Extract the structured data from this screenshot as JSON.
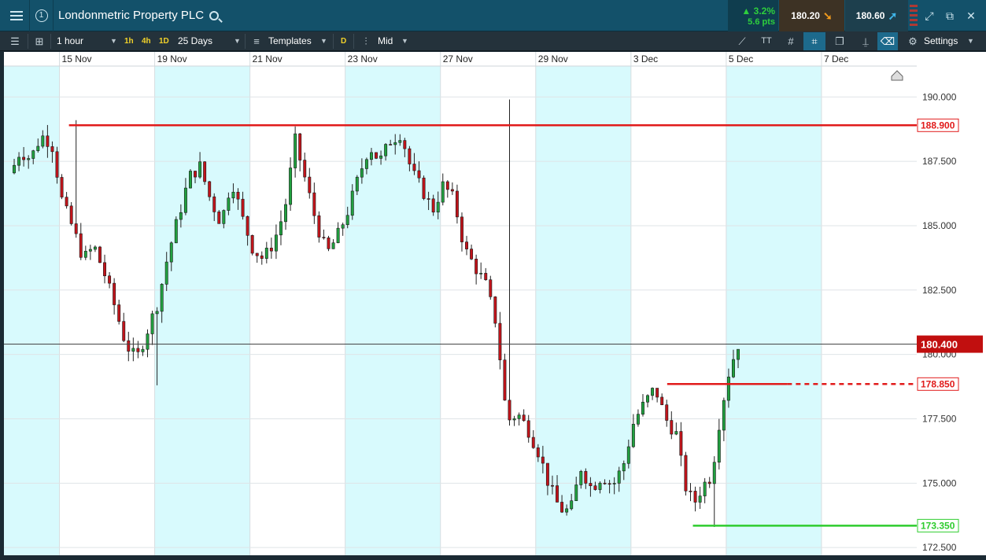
{
  "header": {
    "instrument": "Londonmetric Property PLC",
    "change_pct": "3.2%",
    "change_pts": "5.6 pts",
    "sell_price": "180.20",
    "buy_price": "180.60"
  },
  "toolbar": {
    "interval": "1 hour",
    "quick_intervals": [
      "1h",
      "4h",
      "1D"
    ],
    "range": "25 Days",
    "templates_label": "Templates",
    "d_label": "D",
    "price_type": "Mid",
    "settings_label": "Settings"
  },
  "colors": {
    "up": "#21a140",
    "down": "#c2141b",
    "resistance": "#e11b1b",
    "support": "#2ecc2e",
    "band": "#d8fafd",
    "current_tag": "#c10f0f"
  },
  "chart_data": {
    "type": "candlestick",
    "ylim": [
      172.2,
      191.2
    ],
    "y_ticks": [
      "190.000",
      "187.500",
      "185.000",
      "182.500",
      "180.000",
      "177.500",
      "175.000",
      "172.500"
    ],
    "x_labels": [
      "15 Nov",
      "19 Nov",
      "21 Nov",
      "23 Nov",
      "27 Nov",
      "29 Nov",
      "3 Dec",
      "5 Dec",
      "7 Dec"
    ],
    "current_price": {
      "label": "180.400",
      "value": 180.4
    },
    "horizontal_lines": [
      {
        "label": "188.900",
        "value": 188.9,
        "kind": "resistance"
      },
      {
        "label": "178.850",
        "value": 178.85,
        "kind": "resistance"
      },
      {
        "label": "173.350",
        "value": 173.35,
        "kind": "support"
      }
    ],
    "segments": [
      {
        "count": 20,
        "path": [
          186.9,
          187.9,
          187.6,
          188.5,
          188.2,
          185.9,
          184.9,
          183.7,
          184.2,
          183.1
        ]
      },
      {
        "count": 20,
        "path": [
          183.1,
          181.8,
          180.4,
          179.8,
          180.9,
          182.0,
          183.9,
          185.4,
          186.9,
          187.3
        ]
      },
      {
        "count": 20,
        "path": [
          187.3,
          186.0,
          185.1,
          186.8,
          185.3,
          184.1,
          183.7,
          184.4,
          185.6,
          188.3
        ]
      },
      {
        "count": 20,
        "path": [
          188.3,
          186.7,
          185.1,
          183.9,
          184.6,
          185.6,
          186.9,
          188.1,
          187.5,
          188.3
        ]
      },
      {
        "count": 20,
        "path": [
          188.3,
          188.6,
          187.1,
          186.4,
          185.6,
          186.6,
          186.0,
          184.1,
          183.4,
          182.7
        ]
      },
      {
        "count": 20,
        "path": [
          182.7,
          181.2,
          177.4,
          177.7,
          177.1,
          176.2,
          174.9,
          174.0,
          173.9,
          175.6
        ]
      },
      {
        "count": 20,
        "path": [
          175.6,
          174.8,
          175.3,
          174.9,
          175.7,
          177.4,
          178.1,
          178.7,
          177.5,
          176.9
        ]
      },
      {
        "count": 13,
        "path": [
          176.9,
          174.9,
          174.2,
          174.9,
          175.3,
          177.7,
          179.4,
          180.4
        ]
      }
    ],
    "wick_extremes": [
      {
        "index": 13,
        "high": 189.1
      },
      {
        "index": 30,
        "low": 178.8
      },
      {
        "index": 104,
        "high": 189.9
      },
      {
        "index": 147,
        "low": 173.3
      },
      {
        "index": 161,
        "low": 173.6
      },
      {
        "index": 175,
        "low": 173.6
      },
      {
        "index": 182,
        "low": 173.7
      }
    ]
  }
}
